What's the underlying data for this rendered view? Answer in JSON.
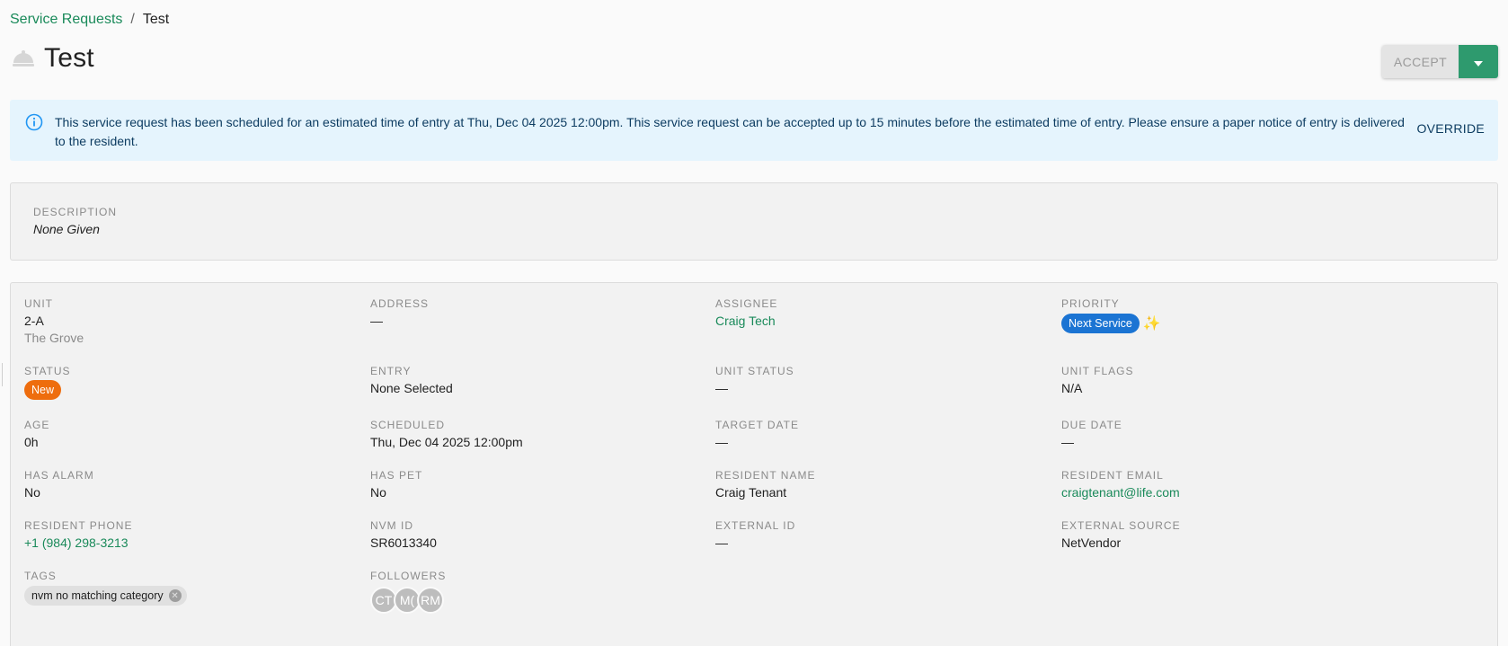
{
  "breadcrumb": {
    "parent": "Service Requests",
    "separator": "/",
    "current": "Test"
  },
  "title": "Test",
  "actions": {
    "accept_label": "ACCEPT"
  },
  "banner": {
    "message": "This service request has been scheduled for an estimated time of entry at Thu, Dec 04 2025 12:00pm. This service request can be accepted up to 15 minutes before the estimated time of entry. Please ensure a paper notice of entry is delivered to the resident.",
    "override_label": "OVERRIDE"
  },
  "description": {
    "label": "DESCRIPTION",
    "value": "None Given"
  },
  "details": {
    "unit": {
      "label": "UNIT",
      "value": "2-A",
      "sub": "The Grove"
    },
    "address": {
      "label": "ADDRESS",
      "value": "—"
    },
    "assignee": {
      "label": "ASSIGNEE",
      "value": "Craig Tech"
    },
    "priority": {
      "label": "PRIORITY",
      "value": "Next Service"
    },
    "status": {
      "label": "STATUS",
      "value": "New"
    },
    "entry": {
      "label": "ENTRY",
      "value": "None Selected"
    },
    "unit_status": {
      "label": "UNIT STATUS",
      "value": "—"
    },
    "unit_flags": {
      "label": "UNIT FLAGS",
      "value": "N/A"
    },
    "age": {
      "label": "AGE",
      "value": "0h"
    },
    "scheduled": {
      "label": "SCHEDULED",
      "value": "Thu, Dec 04 2025 12:00pm"
    },
    "target_date": {
      "label": "TARGET DATE",
      "value": "—"
    },
    "due_date": {
      "label": "DUE DATE",
      "value": "—"
    },
    "has_alarm": {
      "label": "HAS ALARM",
      "value": "No"
    },
    "has_pet": {
      "label": "HAS PET",
      "value": "No"
    },
    "resident_name": {
      "label": "RESIDENT NAME",
      "value": "Craig Tenant"
    },
    "resident_email": {
      "label": "RESIDENT EMAIL",
      "value": "craigtenant@life.com"
    },
    "resident_phone": {
      "label": "RESIDENT PHONE",
      "value": "+1 (984) 298-3213"
    },
    "nvm_id": {
      "label": "NVM ID",
      "value": "SR6013340"
    },
    "external_id": {
      "label": "EXTERNAL ID",
      "value": "—"
    },
    "external_source": {
      "label": "EXTERNAL SOURCE",
      "value": "NetVendor"
    },
    "tags": {
      "label": "TAGS",
      "items": [
        "nvm no matching category"
      ]
    },
    "followers": {
      "label": "FOLLOWERS",
      "avatars": [
        "CT",
        "M(",
        "RM"
      ]
    }
  },
  "colors": {
    "accent_green": "#2e9a6e",
    "link_green": "#1a8a5a",
    "priority_blue": "#1b74d3",
    "status_orange": "#ee6d0e",
    "banner_bg": "#e5f4fd"
  }
}
